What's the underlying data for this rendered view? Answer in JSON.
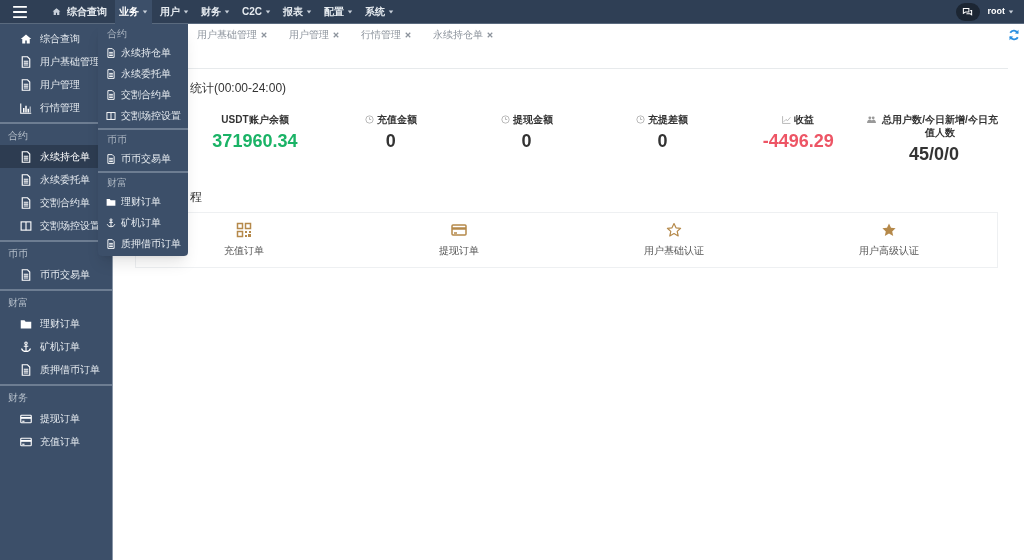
{
  "topbar": {
    "nav": [
      {
        "label": "综合查询",
        "kind": "home",
        "expanded": false
      },
      {
        "label": "业务",
        "kind": "menu",
        "expanded": true
      },
      {
        "label": "用户",
        "kind": "menu",
        "expanded": false
      },
      {
        "label": "财务",
        "kind": "menu",
        "expanded": false
      },
      {
        "label": "C2C",
        "kind": "menu",
        "expanded": false
      },
      {
        "label": "报表",
        "kind": "menu",
        "expanded": false
      },
      {
        "label": "配置",
        "kind": "menu",
        "expanded": false
      },
      {
        "label": "系统",
        "kind": "menu",
        "expanded": false
      }
    ],
    "user": "root"
  },
  "sidebar": {
    "groups": [
      {
        "items": [
          {
            "label": "综合查询",
            "kind": "home",
            "selected": false
          },
          {
            "label": "用户基础管理",
            "kind": "file",
            "selected": false
          },
          {
            "label": "用户管理",
            "kind": "file",
            "selected": false
          },
          {
            "label": "行情管理",
            "kind": "chart",
            "selected": false
          }
        ]
      },
      {
        "label": "合约",
        "items": [
          {
            "label": "永续持仓单",
            "kind": "file",
            "selected": true
          },
          {
            "label": "永续委托单",
            "kind": "file",
            "selected": false
          },
          {
            "label": "交割合约单",
            "kind": "file",
            "selected": false
          },
          {
            "label": "交割场控设置",
            "kind": "columns",
            "selected": false
          }
        ]
      },
      {
        "label": "币币",
        "items": [
          {
            "label": "币币交易单",
            "kind": "file",
            "selected": false
          }
        ]
      },
      {
        "label": "财富",
        "items": [
          {
            "label": "理财订单",
            "kind": "folder",
            "selected": false
          },
          {
            "label": "矿机订单",
            "kind": "anchor",
            "selected": false
          },
          {
            "label": "质押借币订单",
            "kind": "file",
            "selected": false
          }
        ]
      },
      {
        "label": "财务",
        "items": [
          {
            "label": "提现订单",
            "kind": "card",
            "selected": false
          },
          {
            "label": "充值订单",
            "kind": "card",
            "selected": false
          }
        ]
      }
    ]
  },
  "dropdown_menu": {
    "groups": [
      {
        "label": "合约",
        "items": [
          {
            "label": "永续持仓单",
            "kind": "file"
          },
          {
            "label": "永续委托单",
            "kind": "file"
          },
          {
            "label": "交割合约单",
            "kind": "file"
          },
          {
            "label": "交割场控设置",
            "kind": "columns"
          }
        ]
      },
      {
        "label": "币币",
        "items": [
          {
            "label": "币币交易单",
            "kind": "file"
          }
        ]
      },
      {
        "label": "财富",
        "items": [
          {
            "label": "理财订单",
            "kind": "folder"
          },
          {
            "label": "矿机订单",
            "kind": "anchor"
          },
          {
            "label": "质押借币订单",
            "kind": "file"
          }
        ]
      }
    ]
  },
  "tabs": [
    {
      "label": "用户基础管理"
    },
    {
      "label": "用户管理"
    },
    {
      "label": "行情管理"
    },
    {
      "label": "永续持仓单"
    }
  ],
  "stats": {
    "title": "统计(00:00-24:00)",
    "items": [
      {
        "label": "USDT账户余额",
        "kind": "plain",
        "value": "371960.34",
        "color": "#1ab366"
      },
      {
        "label": "充值金额",
        "kind": "clock",
        "value": "0",
        "color": "#333333"
      },
      {
        "label": "提现金额",
        "kind": "clock",
        "value": "0",
        "color": "#333333"
      },
      {
        "label": "充提差额",
        "kind": "clock",
        "value": "0",
        "color": "#333333"
      },
      {
        "label": "收益",
        "kind": "linechart",
        "value": "-4496.29",
        "color": "#ed5565"
      },
      {
        "label": "总用户数/今日新增/今日充值人数",
        "kind": "users",
        "value": "45/0/0",
        "color": "#333333"
      }
    ]
  },
  "shortcuts": {
    "title": "程",
    "items": [
      {
        "label": "充值订单",
        "kind": "qrcode"
      },
      {
        "label": "提现订单",
        "kind": "card"
      },
      {
        "label": "用户基础认证",
        "kind": "star-outline"
      },
      {
        "label": "用户高级认证",
        "kind": "star"
      }
    ]
  }
}
